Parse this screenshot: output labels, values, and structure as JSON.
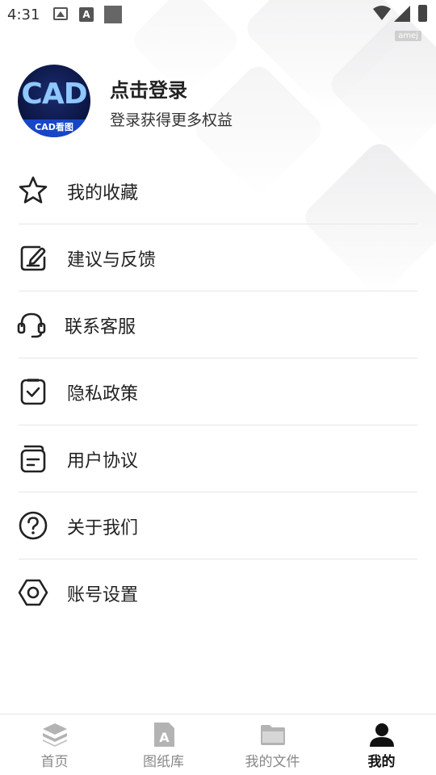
{
  "status_bar": {
    "time": "4:31",
    "badge": "amej"
  },
  "profile": {
    "avatar_text": "CAD",
    "avatar_subtext": "CAD看图",
    "title": "点击登录",
    "subtitle": "登录获得更多权益"
  },
  "menu": {
    "items": [
      {
        "label": "我的收藏",
        "icon": "star-icon"
      },
      {
        "label": "建议与反馈",
        "icon": "edit-note-icon"
      },
      {
        "label": "联系客服",
        "icon": "headset-icon"
      },
      {
        "label": "隐私政策",
        "icon": "check-document-icon"
      },
      {
        "label": "用户协议",
        "icon": "agreement-icon"
      },
      {
        "label": "关于我们",
        "icon": "question-circle-icon"
      },
      {
        "label": "账号设置",
        "icon": "settings-hexagon-icon"
      }
    ]
  },
  "tab_bar": {
    "tabs": [
      {
        "label": "首页",
        "icon": "layers-icon",
        "active": false
      },
      {
        "label": "图纸库",
        "icon": "drawing-file-icon",
        "active": false
      },
      {
        "label": "我的文件",
        "icon": "folder-icon",
        "active": false
      },
      {
        "label": "我的",
        "icon": "user-icon",
        "active": true
      }
    ]
  },
  "colors": {
    "active_tab": "#111111",
    "inactive_tab": "#888888",
    "avatar_bg": "#0a1440",
    "avatar_band": "#1646c8"
  }
}
